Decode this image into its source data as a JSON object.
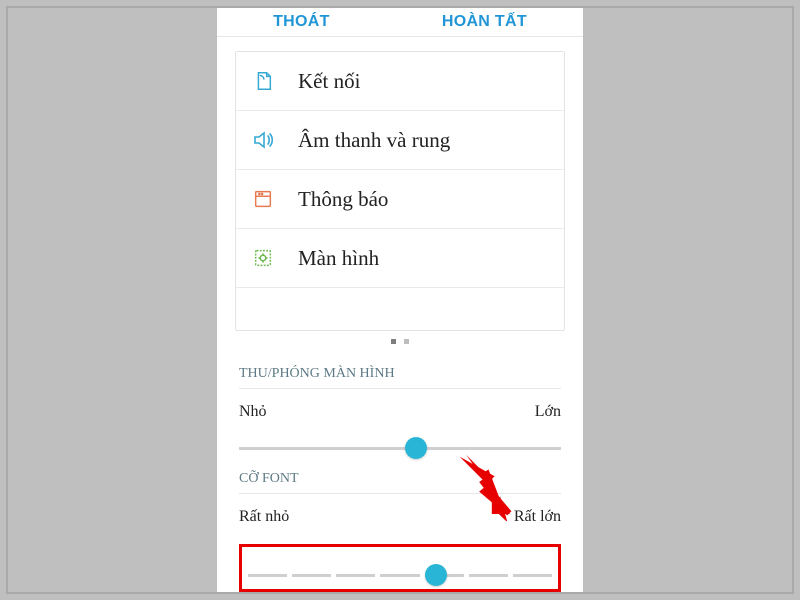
{
  "topbar": {
    "cancel_label": "THOÁT",
    "done_label": "HOÀN TẤT"
  },
  "settings_list": {
    "items": [
      {
        "label": "Kết nối"
      },
      {
        "label": "Âm thanh và rung"
      },
      {
        "label": "Thông báo"
      },
      {
        "label": "Màn hình"
      }
    ]
  },
  "zoom_section": {
    "title": "THU/PHÓNG MÀN HÌNH",
    "min_label": "Nhỏ",
    "max_label": "Lớn",
    "value_percent": 55
  },
  "font_section": {
    "title": "CỠ FONT",
    "min_label": "Rất nhỏ",
    "max_label": "Rất lớn",
    "value_percent": 62
  },
  "colors": {
    "accent": "#2196d6",
    "slider_thumb": "#29b6d6",
    "highlight": "#e60000"
  }
}
